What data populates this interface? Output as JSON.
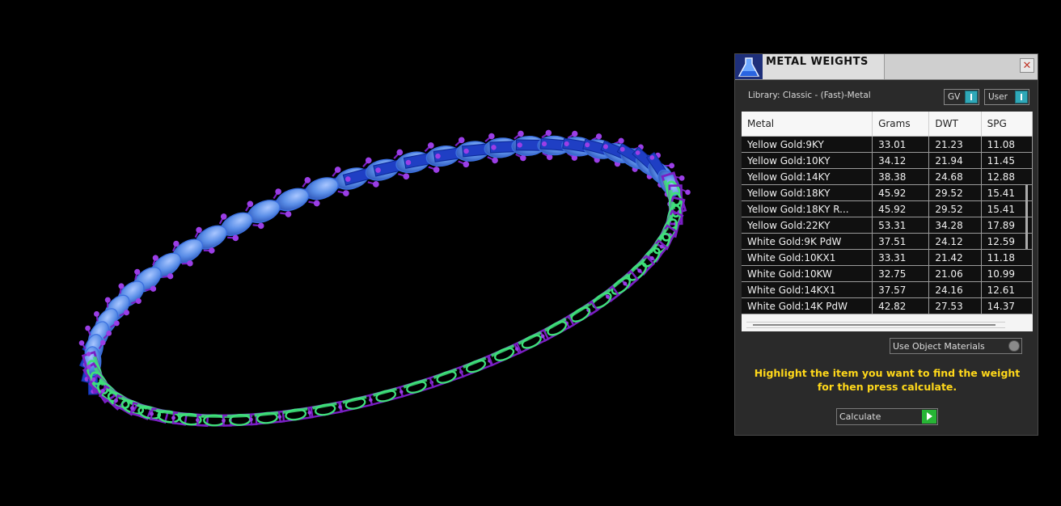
{
  "panel": {
    "title": "METAL WEIGHTS",
    "close_glyph": "✕",
    "library_label": "Library: Classic - (Fast)-Metal",
    "toggles": {
      "gv": "GV",
      "user": "User"
    },
    "columns": [
      "Metal",
      "Grams",
      "DWT",
      "SPG"
    ],
    "rows": [
      [
        "Yellow Gold:9KY",
        "33.01",
        "21.23",
        "11.08"
      ],
      [
        "Yellow Gold:10KY",
        "34.12",
        "21.94",
        "11.45"
      ],
      [
        "Yellow Gold:14KY",
        "38.38",
        "24.68",
        "12.88"
      ],
      [
        "Yellow Gold:18KY",
        "45.92",
        "29.52",
        "15.41"
      ],
      [
        "Yellow Gold:18KY R...",
        "45.92",
        "29.52",
        "15.41"
      ],
      [
        "Yellow Gold:22KY",
        "53.31",
        "34.28",
        "17.89"
      ],
      [
        "White Gold:9K PdW",
        "37.51",
        "24.12",
        "12.59"
      ],
      [
        "White Gold:10KX1",
        "33.31",
        "21.42",
        "11.18"
      ],
      [
        "White Gold:10KW",
        "32.75",
        "21.06",
        "10.99"
      ],
      [
        "White Gold:14KX1",
        "37.57",
        "24.16",
        "12.61"
      ],
      [
        "White Gold:14K PdW",
        "42.82",
        "27.53",
        "14.37"
      ]
    ],
    "materials_button": "Use Object Materials",
    "instructions": "Highlight the item you want to find the weight for then press calculate.",
    "calculate_button": "Calculate"
  },
  "colors": {
    "background": "#000000",
    "stone_blue": "#5b8fe8",
    "setting_blue": "#1f3fc4",
    "prong_purple": "#7a1fc4",
    "metal_green": "#3ee07a",
    "instructions_text": "#ffd81a",
    "toggle_accent": "#2fa8b8",
    "calculate_accent": "#27b535"
  },
  "icons": {
    "app": "flask-icon",
    "close": "close-icon",
    "go": "play-arrow-icon"
  }
}
